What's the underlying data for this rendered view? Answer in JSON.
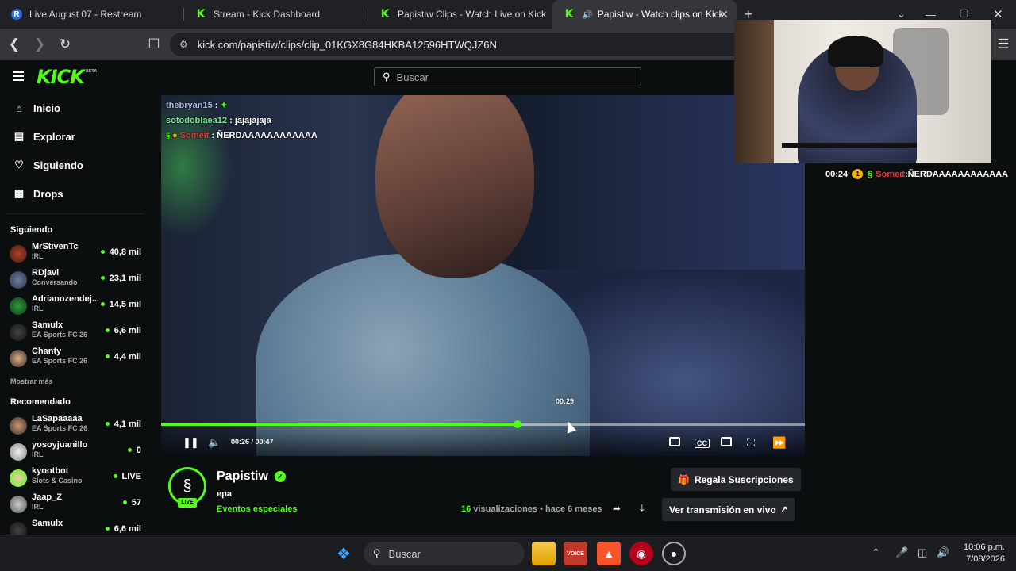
{
  "tabs": [
    {
      "title": "Live August 07 - Restream",
      "icon": "restream-icon"
    },
    {
      "title": "Stream - Kick Dashboard",
      "icon": "kick-icon"
    },
    {
      "title": "Papistiw Clips - Watch Live on Kick",
      "icon": "kick-icon"
    },
    {
      "title": "Papistiw - Watch clips on Kick",
      "icon": "kick-icon",
      "active": true
    }
  ],
  "address": {
    "url": "kick.com/papistiw/clips/clip_01KGX8G84HKBA12596HTWQJZ6N"
  },
  "header": {
    "search_placeholder": "Buscar",
    "logo": "KICK",
    "logo_tag": "BETA"
  },
  "sidebar": {
    "nav": [
      {
        "label": "Inicio",
        "icon": "home-icon"
      },
      {
        "label": "Explorar",
        "icon": "browse-icon"
      },
      {
        "label": "Siguiendo",
        "icon": "heart-icon"
      },
      {
        "label": "Drops",
        "icon": "drops-icon"
      }
    ],
    "following_title": "Siguiendo",
    "following": [
      {
        "name": "MrStivenTc",
        "category": "IRL",
        "viewers": "40,8 mil"
      },
      {
        "name": "RDjavi",
        "category": "Conversando",
        "viewers": "23,1 mil"
      },
      {
        "name": "Adrianozendej...",
        "category": "IRL",
        "viewers": "14,5 mil"
      },
      {
        "name": "Samulx",
        "category": "EA Sports FC 26",
        "viewers": "6,6 mil"
      },
      {
        "name": "Chanty",
        "category": "EA Sports FC 26",
        "viewers": "4,4 mil"
      }
    ],
    "show_more": "Mostrar más",
    "recommended_title": "Recomendado",
    "recommended": [
      {
        "name": "LaSapaaaaa",
        "category": "EA Sports FC 26",
        "viewers": "4,1 mil"
      },
      {
        "name": "yosoyjuanillo",
        "category": "IRL",
        "viewers": "0"
      },
      {
        "name": "kyootbot",
        "category": "Slots & Casino",
        "viewers": "LIVE"
      },
      {
        "name": "Jaap_Z",
        "category": "IRL",
        "viewers": "57"
      },
      {
        "name": "Samulx",
        "category": "",
        "viewers": "6,6 mil"
      }
    ]
  },
  "player": {
    "chat": [
      {
        "user": "thebryan15",
        "text": ""
      },
      {
        "user": "sotodoblaea12",
        "text": "jajajajaja"
      },
      {
        "user": "Someit",
        "text": "ÑERDAAAAAAAAAAAA"
      }
    ],
    "hover_time": "00:29",
    "time": "00:26 / 00:47",
    "progress": 0.5533
  },
  "pinned_chat": {
    "time": "00:24",
    "badge": "1",
    "user": "Someit",
    "text": "ÑERDAAAAAAAAAAAA"
  },
  "stream": {
    "channel": "Papistiw",
    "live_badge": "LIVE",
    "title": "epa",
    "category": "Eventos especiales",
    "views_count": "16",
    "views_label": "visualizaciones",
    "age": "• hace 6 meses",
    "gift_button": "Regala Suscripciones",
    "watch_live_button": "Ver transmisión en vivo"
  },
  "taskbar": {
    "search": "Buscar",
    "time": "10:06 p.m.",
    "date": "7/08/2026"
  },
  "colors": {
    "accent": "#53fc18",
    "background": "#0b0e0f"
  }
}
